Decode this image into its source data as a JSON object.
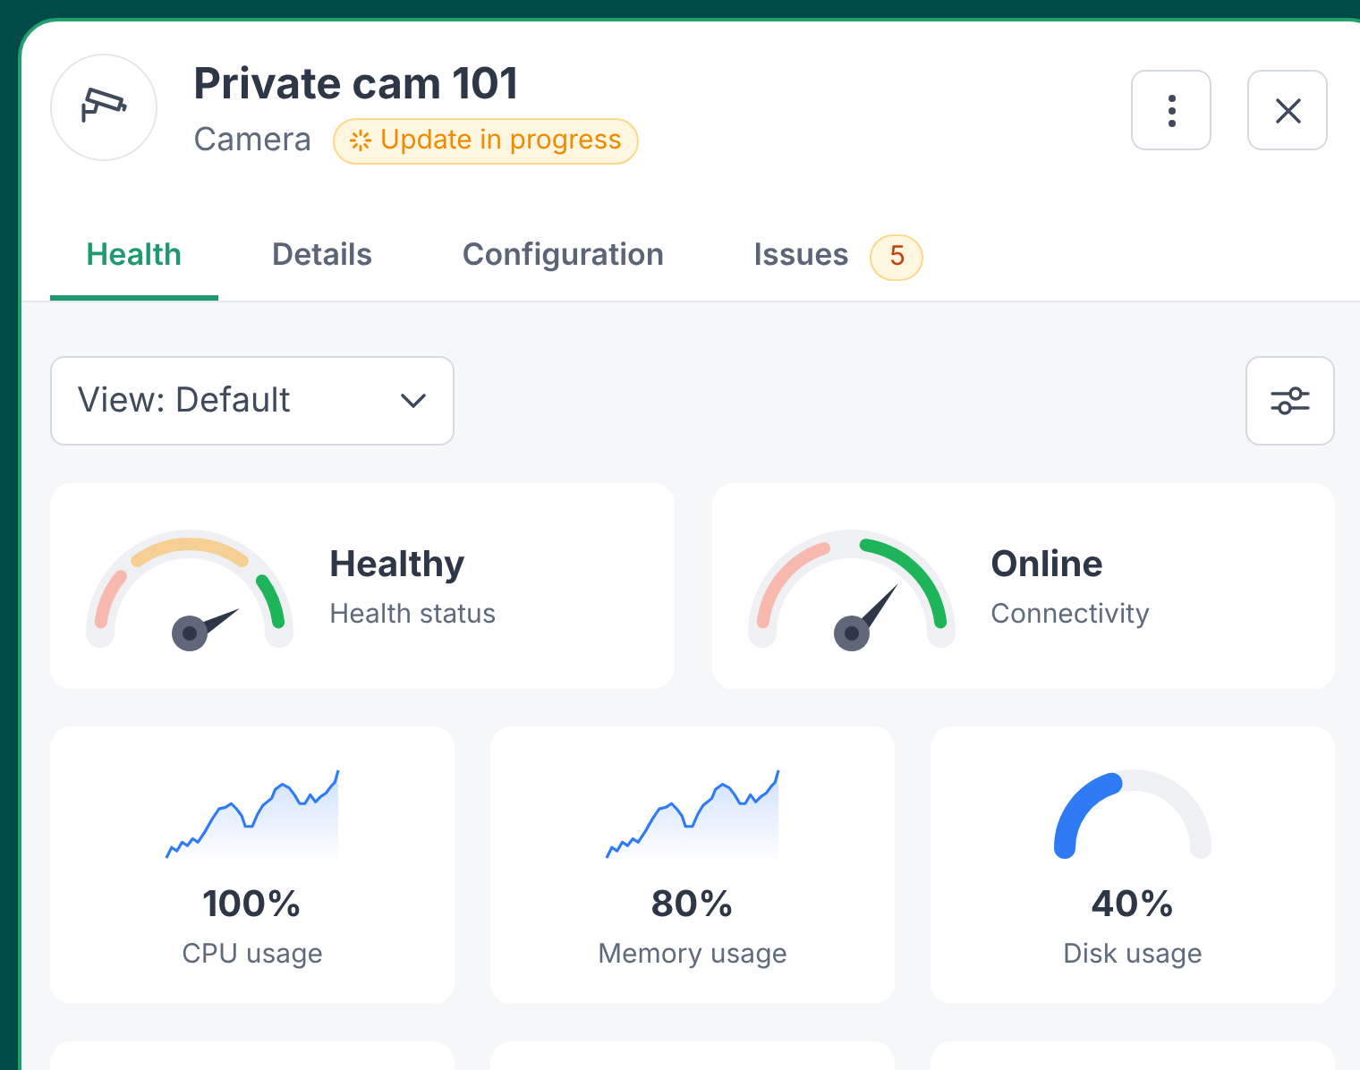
{
  "device": {
    "title": "Private cam 101",
    "type": "Camera",
    "status_badge": "Update in progress"
  },
  "tabs": [
    {
      "label": "Health",
      "selected": true
    },
    {
      "label": "Details",
      "selected": false
    },
    {
      "label": "Configuration",
      "selected": false
    },
    {
      "label": "Issues",
      "selected": false,
      "count": "5"
    }
  ],
  "view_select": {
    "value": "View: Default"
  },
  "status_cards": [
    {
      "value": "Healthy",
      "label": "Health status",
      "kind": "health"
    },
    {
      "value": "Online",
      "label": "Connectivity",
      "kind": "connectivity"
    }
  ],
  "metric_cards": [
    {
      "value": "100%",
      "label": "CPU usage",
      "kind": "sparkline"
    },
    {
      "value": "80%",
      "label": "Memory usage",
      "kind": "sparkline"
    },
    {
      "value": "40%",
      "label": "Disk usage",
      "kind": "meter",
      "level": 0.4
    }
  ]
}
